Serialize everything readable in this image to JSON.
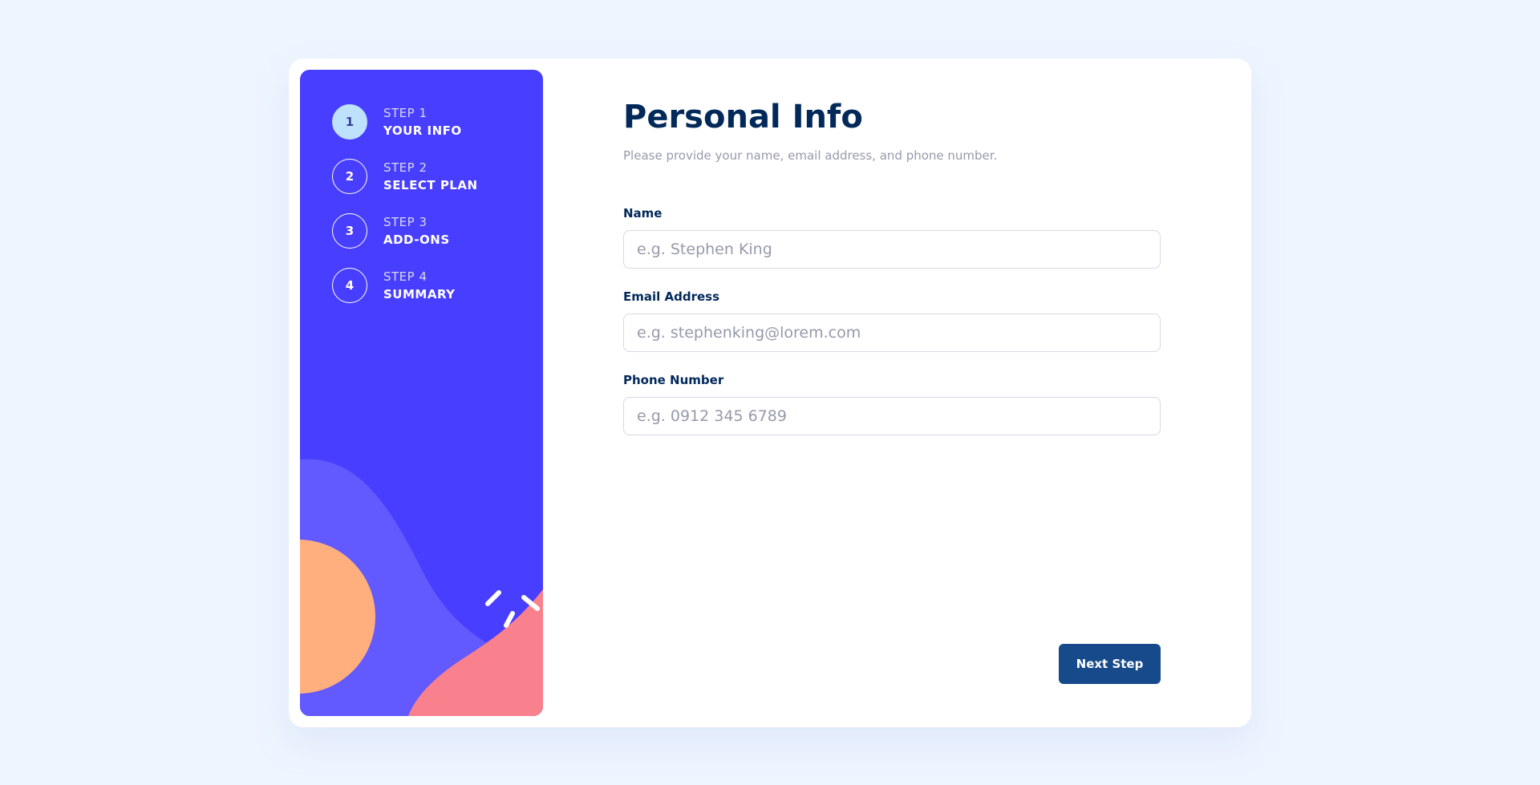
{
  "sidebar": {
    "steps": [
      {
        "number": "1",
        "step_label": "STEP 1",
        "title": "YOUR INFO",
        "active": true
      },
      {
        "number": "2",
        "step_label": "STEP 2",
        "title": "SELECT PLAN",
        "active": false
      },
      {
        "number": "3",
        "step_label": "STEP 3",
        "title": "ADD-ONS",
        "active": false
      },
      {
        "number": "4",
        "step_label": "STEP 4",
        "title": "SUMMARY",
        "active": false
      }
    ]
  },
  "main": {
    "title": "Personal Info",
    "subtitle": "Please provide your name, email address, and phone number.",
    "fields": [
      {
        "label": "Name",
        "placeholder": "e.g. Stephen King",
        "value": ""
      },
      {
        "label": "Email Address",
        "placeholder": "e.g. stephenking@lorem.com",
        "value": ""
      },
      {
        "label": "Phone Number",
        "placeholder": "e.g. 0912 345 6789",
        "value": ""
      }
    ],
    "next_button": "Next Step"
  },
  "colors": {
    "page_bg": "#eef5ff",
    "sidebar_bg": "#483eff",
    "active_step": "#bee2fd",
    "title": "#02295a",
    "muted": "#9699ab",
    "button_bg": "#164a8a",
    "shape_purple": "#6259ff",
    "shape_orange": "#ffaf7e",
    "shape_pink": "#f9818e"
  }
}
